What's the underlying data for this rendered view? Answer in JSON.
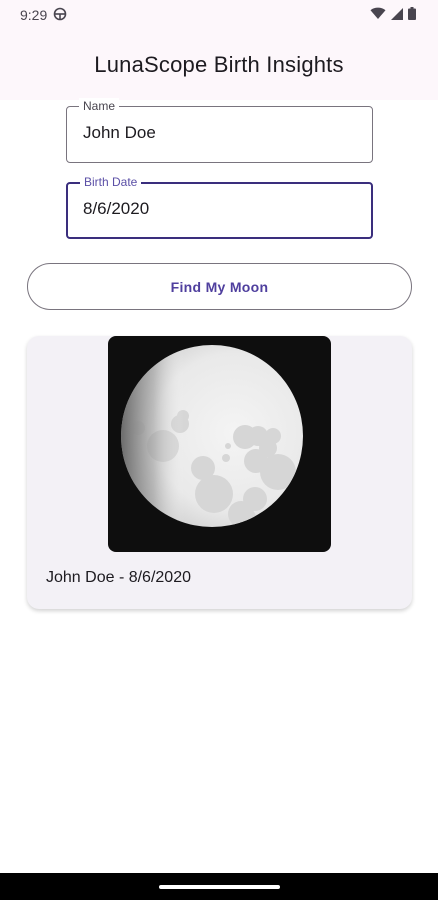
{
  "status_bar": {
    "time": "9:29",
    "icons": [
      "settings-target-icon",
      "wifi-icon",
      "cellular-signal-icon",
      "battery-icon"
    ]
  },
  "app_bar": {
    "title": "LunaScope Birth Insights",
    "background": "#fdf7fb"
  },
  "form": {
    "name_field": {
      "label": "Name",
      "value": "John Doe"
    },
    "birth_date_field": {
      "label": "Birth Date",
      "value": "8/6/2020",
      "focused": true
    }
  },
  "actions": {
    "find_button_label": "Find My Moon",
    "accent_color": "#4f3f9e"
  },
  "result_card": {
    "image_icon": "moon-phase-image",
    "caption": "John Doe - 8/6/2020"
  }
}
